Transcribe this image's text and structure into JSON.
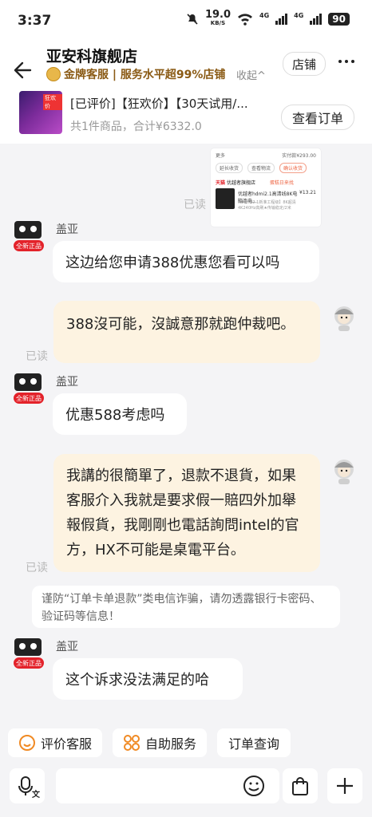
{
  "status_bar": {
    "time": "3:37",
    "net_speed": "19.0",
    "net_unit": "KB/S",
    "net_label_1": "4G",
    "net_label_2": "4G",
    "battery": "90"
  },
  "header": {
    "shop_name": "亚安科旗舰店",
    "shop_subtitle": "金牌客服 | 服务水平超99%店铺",
    "collapse_label": "收起^",
    "shop_button": "店铺"
  },
  "order": {
    "title": "[已评价]【狂欢价】【30天试用/...",
    "summary": "共1件商品，合计¥6332.0",
    "button": "查看订单",
    "thumb_tag": "狂欢价"
  },
  "product_card": {
    "paid_label": "实付款¥293.00",
    "more": "更多",
    "buttons": [
      "延长收货",
      "查看物流",
      "确认收货"
    ],
    "store_prefix": "天猫",
    "store_name": "优越者旗舰店",
    "store_tag": "蛋糕日来找",
    "product_name": "优越者hdmi2.1高清线8K电脑连电...",
    "product_price": "¥13.21",
    "product_spec": "【HDMI2.1新准工程级】8K超清4K240Hz高刷★传输稳定/2米"
  },
  "messages": [
    {
      "side": "left",
      "sender": "盖亚",
      "badge": "全新正品",
      "text": "这边给您申请388优惠您看可以吗"
    },
    {
      "side": "right",
      "read": "已读",
      "text": "388沒可能，沒誠意那就跑仲裁吧。"
    },
    {
      "side": "left",
      "sender": "盖亚",
      "badge": "全新正品",
      "text": "优惠588考虑吗"
    },
    {
      "side": "right",
      "read": "已读",
      "text": "我講的很簡單了，退款不退貨，如果客服介入我就是要求假一賠四外加舉報假貨，我剛剛也電話詢問intel的官方，HX不可能是桌電平台。"
    },
    {
      "side": "left",
      "sender": "盖亚",
      "badge": "全新正品",
      "text": "这个诉求没法满足的哈"
    }
  ],
  "card_read": "已读",
  "notice": "谨防“订单卡单退款”类电信诈骗，请勿透露银行卡密码、验证码等信息！",
  "quick_actions": [
    "评价客服",
    "自助服务",
    "订单查询"
  ],
  "input": {
    "voice_label": "文"
  },
  "colors": {
    "right_bubble": "#fdf3e1",
    "accent_red": "#e3222a",
    "gold": "#8a5a14"
  }
}
